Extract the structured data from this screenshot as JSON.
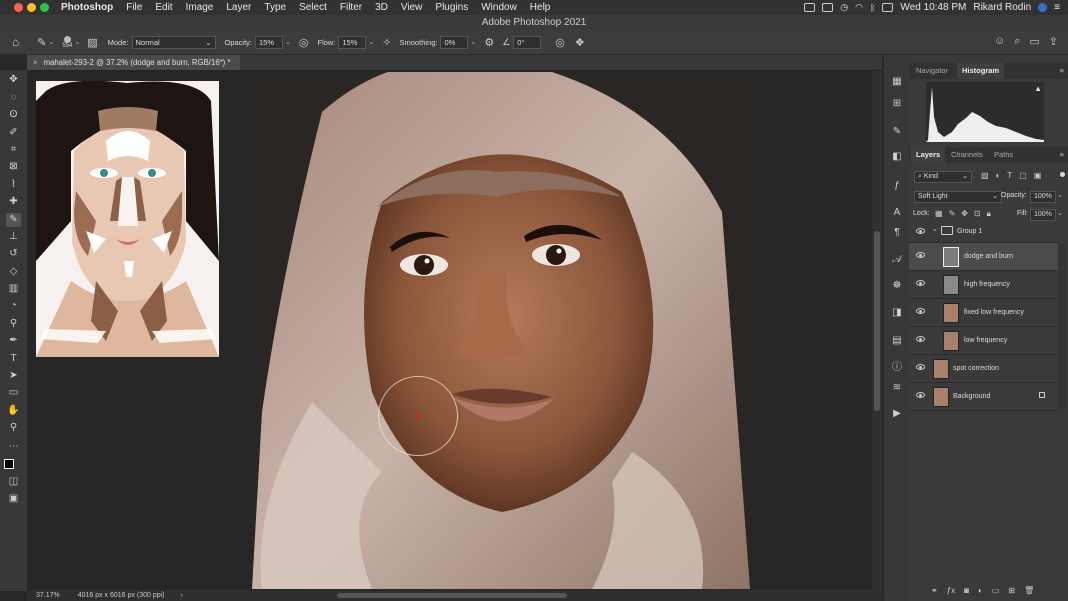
{
  "menubar": {
    "app_name": "Photoshop",
    "items": [
      "File",
      "Edit",
      "Image",
      "Layer",
      "Type",
      "Select",
      "Filter",
      "3D",
      "View",
      "Plugins",
      "Window",
      "Help"
    ],
    "clock": "Wed 10:48 PM",
    "user": "Rikard Rodin"
  },
  "window": {
    "title": "Adobe Photoshop 2021"
  },
  "options": {
    "brush_size": "554",
    "mode_label": "Mode:",
    "mode_value": "Normal",
    "opacity_label": "Opacity:",
    "opacity_value": "15%",
    "flow_label": "Flow:",
    "flow_value": "15%",
    "smoothing_label": "Smoothing:",
    "smoothing_value": "0%",
    "angle_value": "0°"
  },
  "document": {
    "tab_label": "mahalet-293-2 @ 37.2% (dodge and burn, RGB/16*) *"
  },
  "status": {
    "zoom": "37.17%",
    "doc_info": "4016 px x 6016 px (300 ppi)"
  },
  "panels": {
    "top_tabs": [
      "Navigator",
      "Histogram"
    ],
    "layer_tabs": [
      "Layers",
      "Channels",
      "Paths"
    ],
    "filter_kind": "Kind",
    "blend_mode": "Soft Light",
    "opacity_label": "Opacity:",
    "opacity_value": "100%",
    "lock_label": "Lock:",
    "fill_label": "Fill:",
    "fill_value": "100%",
    "layers": [
      {
        "name": "Group 1",
        "type": "group"
      },
      {
        "name": "dodge and burn",
        "type": "layer",
        "selected": true
      },
      {
        "name": "high frequency",
        "type": "layer"
      },
      {
        "name": "fixed low frequency",
        "type": "layer"
      },
      {
        "name": "low frequency",
        "type": "layer"
      },
      {
        "name": "spot correction",
        "type": "layer"
      },
      {
        "name": "Background",
        "type": "layer",
        "locked": true
      }
    ]
  },
  "colors": {
    "accent": "#3a3a3a",
    "brush_cursor_center": "#e0201a"
  }
}
